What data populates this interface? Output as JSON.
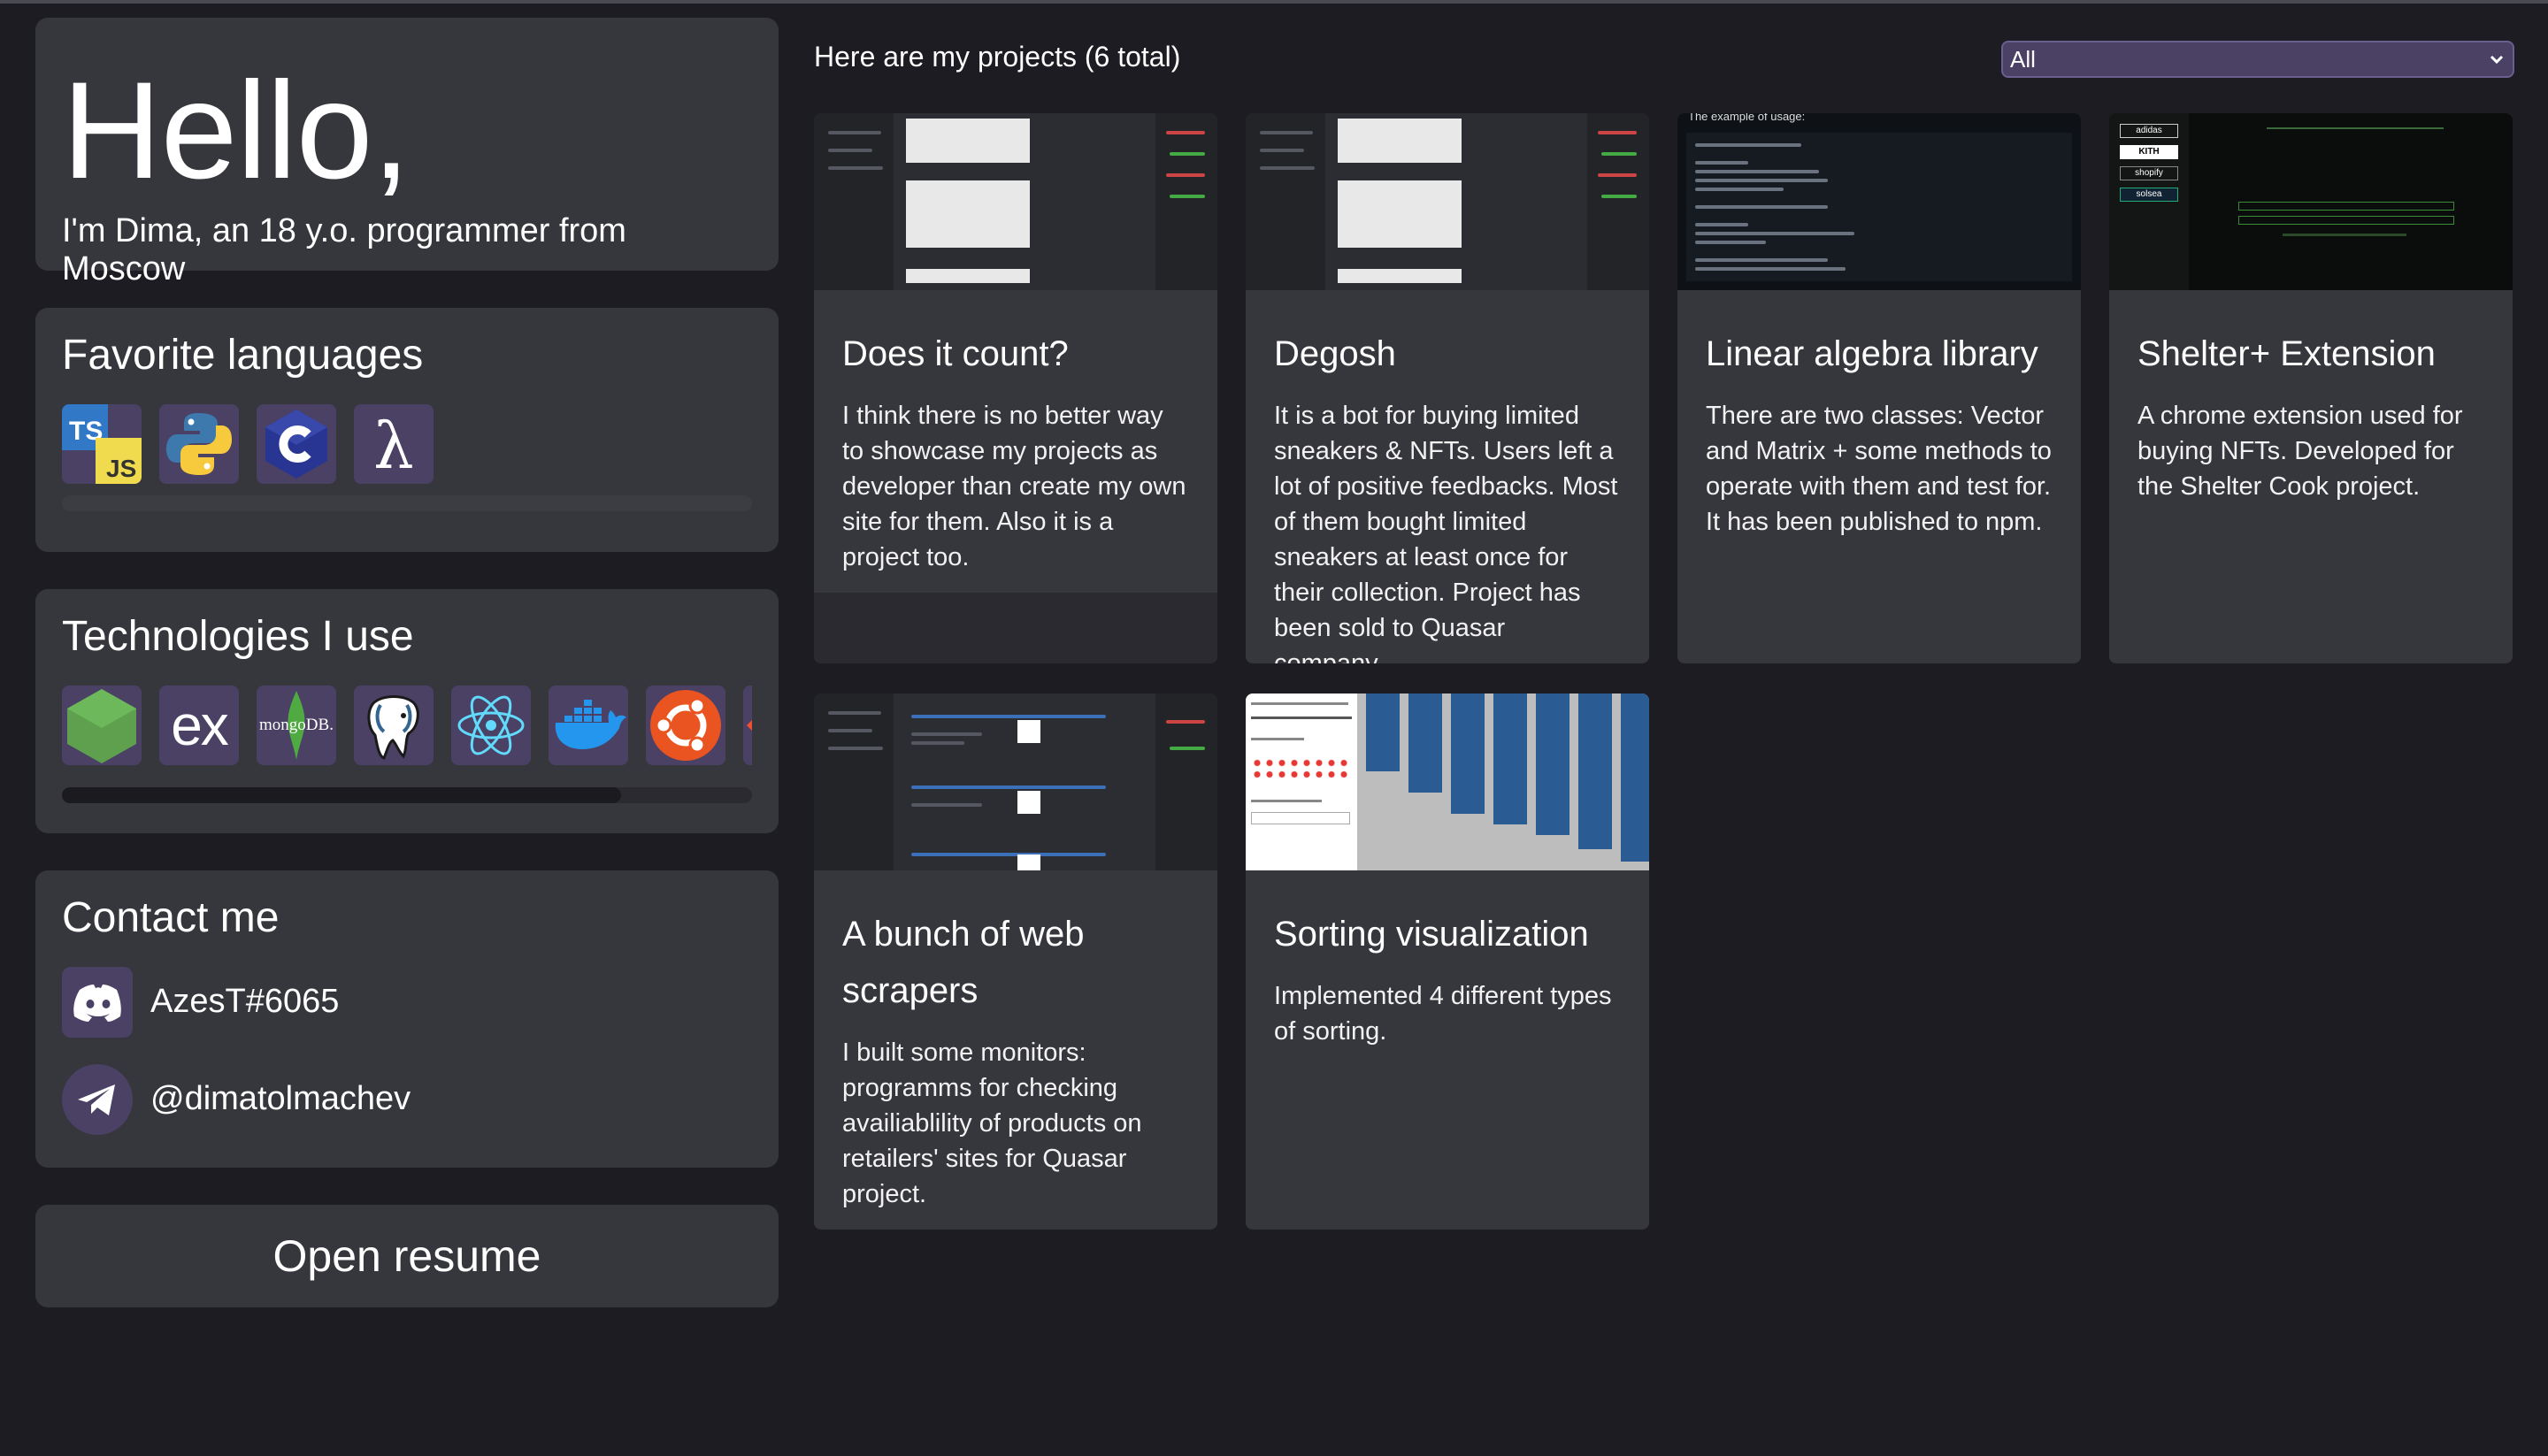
{
  "profile": {
    "greeting": "Hello,",
    "intro": "I'm Dima, an 18 y.o. programmer from Moscow"
  },
  "languages": {
    "title": "Favorite languages",
    "icons": [
      "typescript-javascript-icon",
      "python-icon",
      "c-icon",
      "lambda-icon"
    ],
    "scroll_position": 0.0
  },
  "technologies": {
    "title": "Technologies I use",
    "icons": [
      "nodejs-icon",
      "express-icon",
      "mongodb-icon",
      "postgresql-icon",
      "react-icon",
      "docker-icon",
      "ubuntu-icon",
      "git-icon"
    ],
    "express_label": "ex",
    "mongodb_label": "mongoDB.",
    "scroll_fraction_visible": 0.81
  },
  "contact": {
    "title": "Contact me",
    "discord": "AzesT#6065",
    "telegram": "@dimatolmachev"
  },
  "resume": {
    "label": "Open resume"
  },
  "projects_header": "Here are my projects (6 total)",
  "filter": {
    "selected": "All"
  },
  "projects": [
    {
      "title": "Does it count?",
      "description": "I think there is no better way to showcase my projects as developer than create my own site for them. Also it is a project too."
    },
    {
      "title": "Degosh",
      "description": "It is a bot for buying limited sneakers & NFTs. Users left a lot of positive feedbacks. Most of them bought limited sneakers at least once for their collection. Project has been sold to Quasar company."
    },
    {
      "title": "Linear algebra library",
      "description": "There are two classes: Vector and Matrix + some methods to operate with them and test for. It has been published to npm."
    },
    {
      "title": "Shelter+ Extension",
      "description": "A chrome extension used for buying NFTs. Developed for the Shelter Cook project."
    },
    {
      "title": "A bunch of web scrapers",
      "description": "I built some monitors: programms for checking availiablility of products on retailers' sites for Quasar project."
    },
    {
      "title": "Sorting visualization",
      "description": "Implemented 4 different types of sorting."
    }
  ],
  "thumb_text": {
    "code_header": "The example of usage:",
    "sneaker_brands": [
      "adidas",
      "KITH",
      "shopify",
      "solsea"
    ]
  },
  "colors": {
    "background": "#1c1c22",
    "card": "#36363d",
    "tile": "#4a4165",
    "sort_bar": "#2a5b93"
  }
}
